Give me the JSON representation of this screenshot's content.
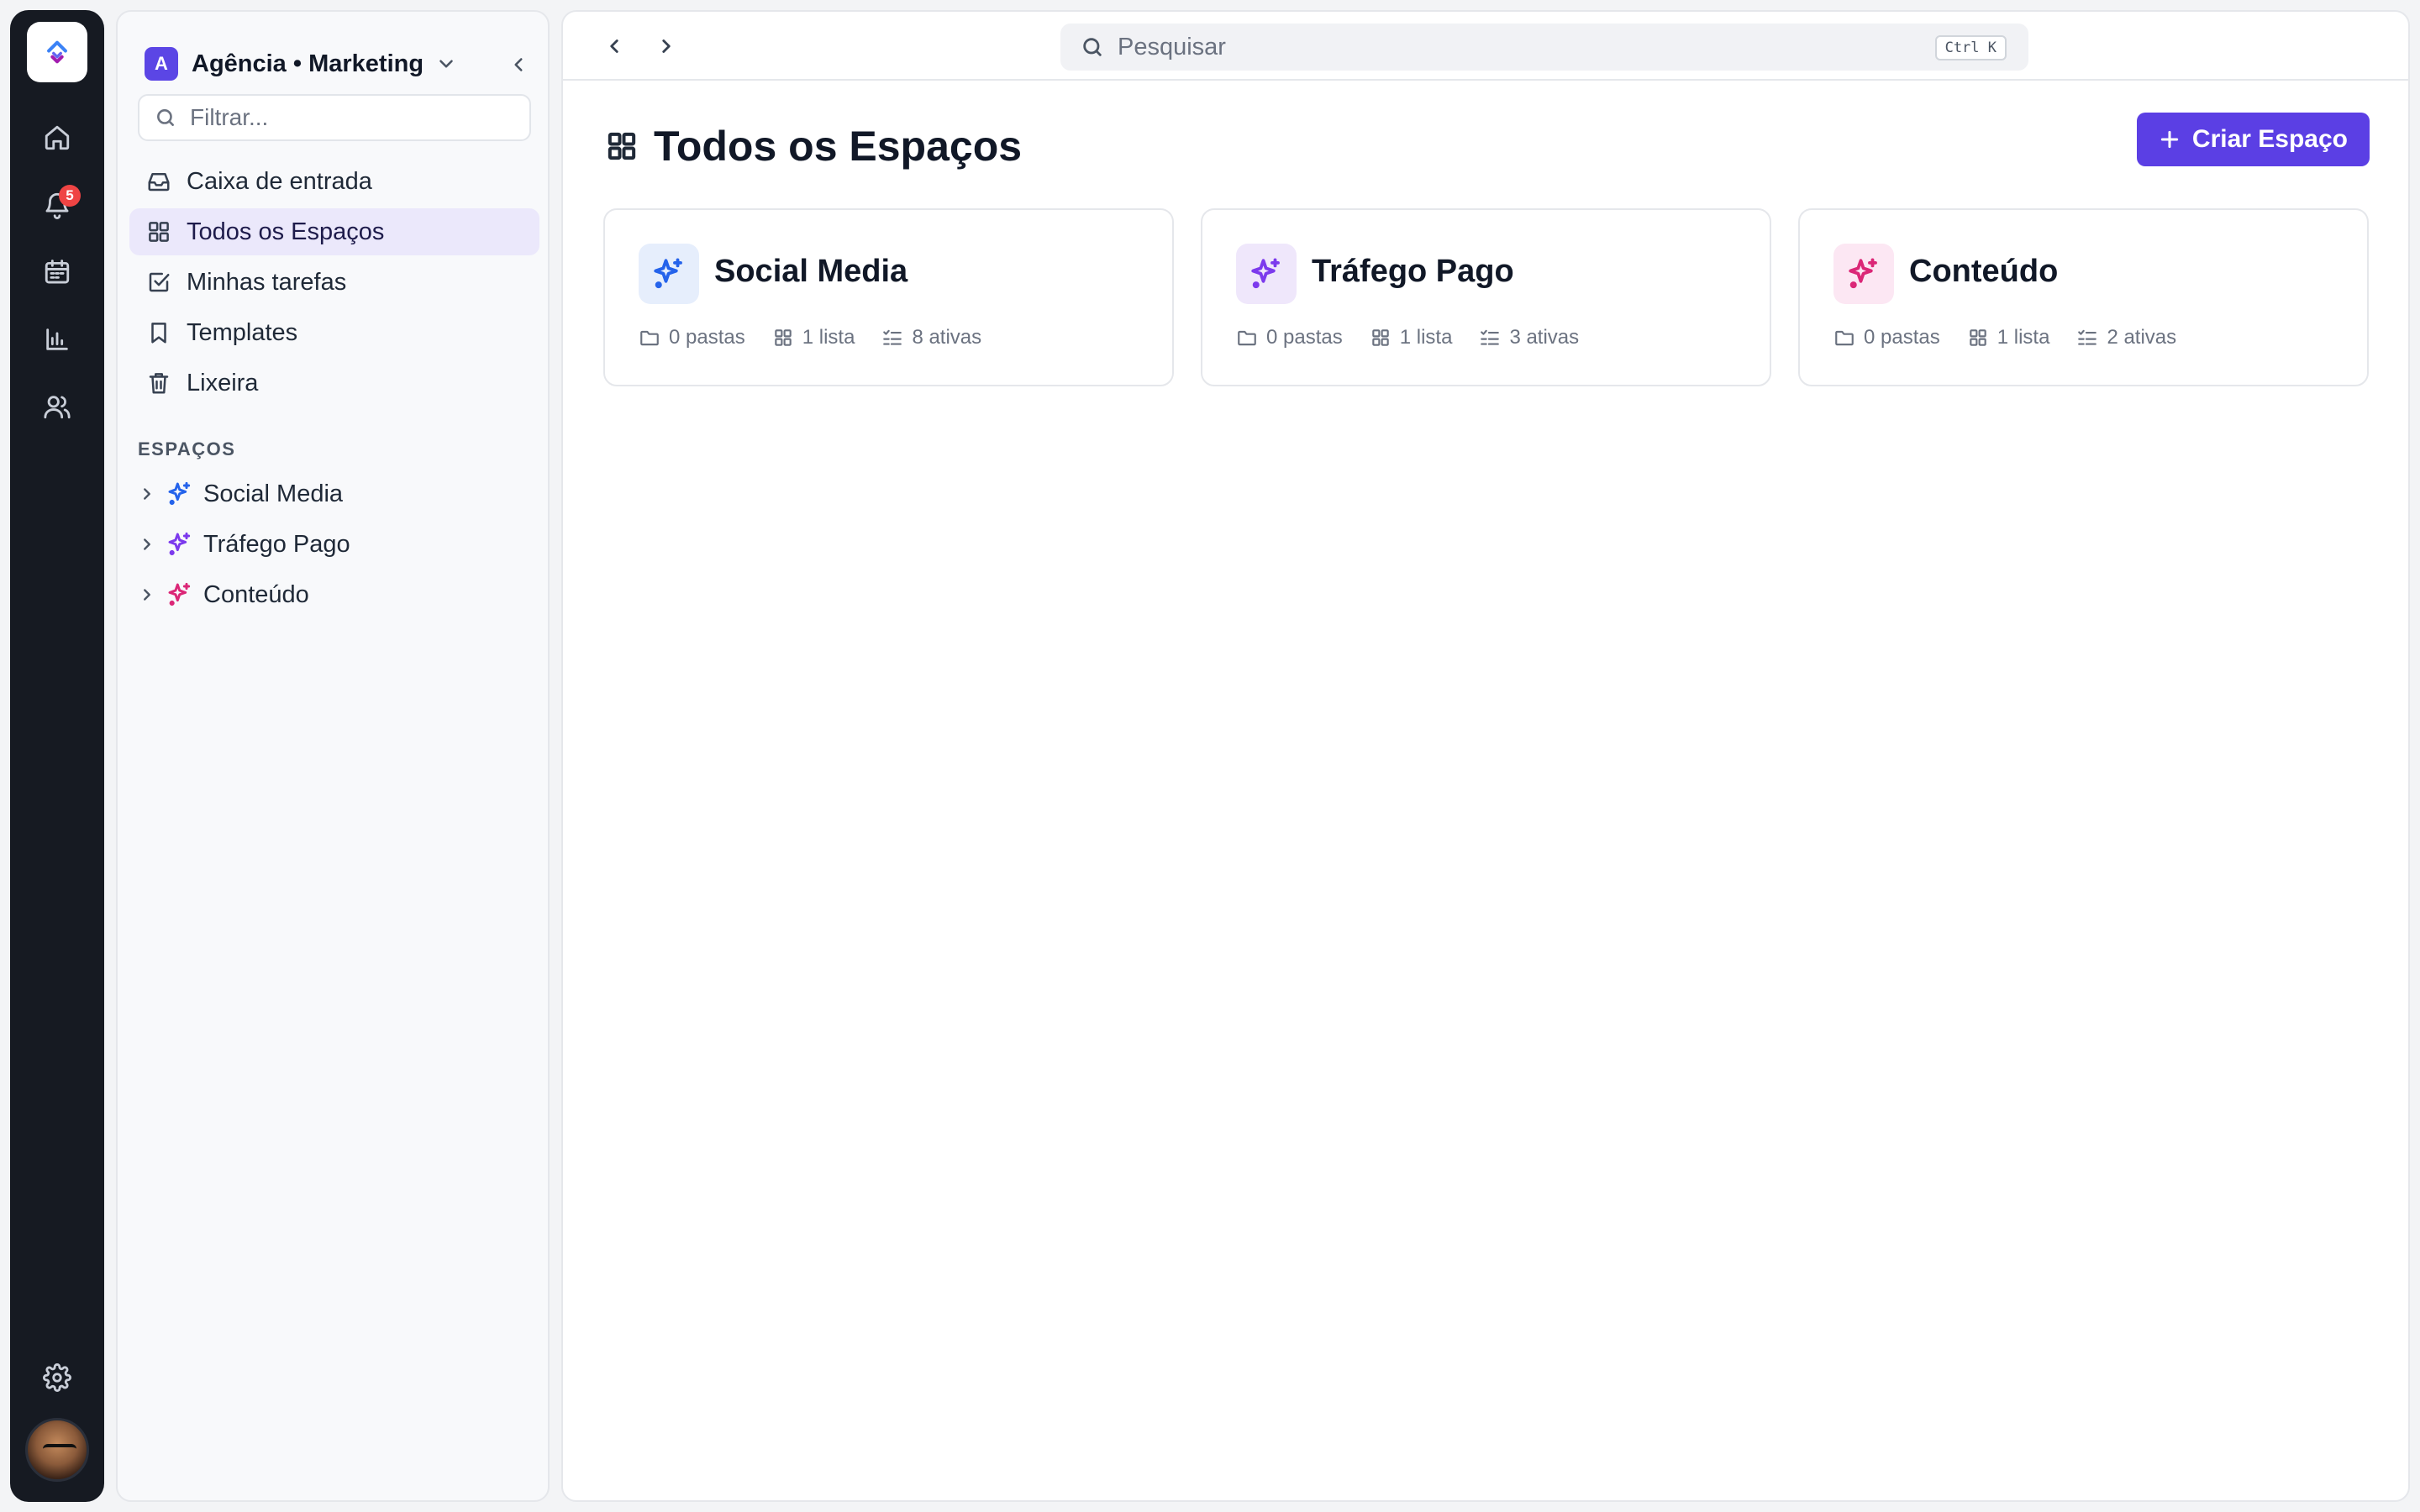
{
  "rail": {
    "notification_count": "5",
    "items": [
      "home-icon",
      "bell-icon",
      "calendar-icon",
      "chart-icon",
      "users-icon",
      "gear-icon"
    ]
  },
  "sidebar": {
    "workspace_initial": "A",
    "workspace_name": "Agência • Marketing",
    "filter_placeholder": "Filtrar...",
    "nav": [
      {
        "label": "Caixa de entrada",
        "icon": "inbox-icon"
      },
      {
        "label": "Todos os Espaços",
        "icon": "grid-icon",
        "active": true
      },
      {
        "label": "Minhas tarefas",
        "icon": "checkbox-icon"
      },
      {
        "label": "Templates",
        "icon": "bookmark-icon"
      },
      {
        "label": "Lixeira",
        "icon": "trash-icon"
      }
    ],
    "spaces_title": "ESPAÇOS",
    "spaces": [
      {
        "label": "Social Media",
        "color": "#2563eb"
      },
      {
        "label": "Tráfego Pago",
        "color": "#7c3aed"
      },
      {
        "label": "Conteúdo",
        "color": "#db2777"
      }
    ]
  },
  "topbar": {
    "search_placeholder": "Pesquisar",
    "shortcut": "Ctrl K"
  },
  "page": {
    "title": "Todos os Espaços",
    "create_label": "Criar Espaço"
  },
  "cards": [
    {
      "title": "Social Media",
      "color": "#2563eb",
      "bg": "#e6eefc",
      "folders": "0 pastas",
      "lists": "1 lista",
      "active": "8 ativas"
    },
    {
      "title": "Tráfego Pago",
      "color": "#7c3aed",
      "bg": "#efe7fb",
      "folders": "0 pastas",
      "lists": "1 lista",
      "active": "3 ativas"
    },
    {
      "title": "Conteúdo",
      "color": "#db2777",
      "bg": "#fce7f3",
      "folders": "0 pastas",
      "lists": "1 lista",
      "active": "2 ativas"
    }
  ]
}
